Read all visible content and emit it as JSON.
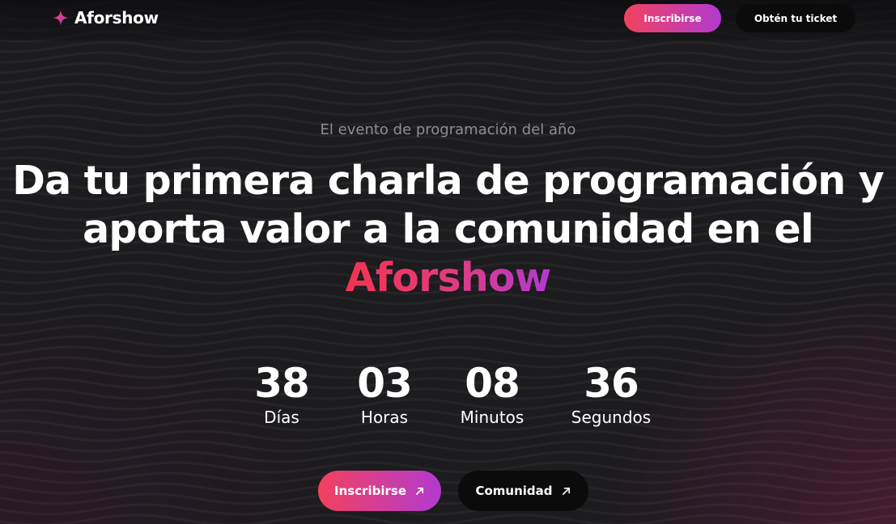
{
  "brand": {
    "name": "Aforshow",
    "logo_icon": "sparkle-icon",
    "accent_start": "#f2415e",
    "accent_end": "#b23ad0"
  },
  "nav": {
    "signup_label": "Inscribirse",
    "ticket_label": "Obtén tu ticket"
  },
  "hero": {
    "eyebrow": "El evento de programación del año",
    "headline_line1": "Da tu primera charla de programación y",
    "headline_line2": "aporta valor a la comunidad en el",
    "headline_brand": "Aforshow"
  },
  "countdown": [
    {
      "value": "38",
      "label": "Días"
    },
    {
      "value": "03",
      "label": "Horas"
    },
    {
      "value": "08",
      "label": "Minutos"
    },
    {
      "value": "36",
      "label": "Segundos"
    }
  ],
  "cta": {
    "signup_label": "Inscribirse",
    "signup_icon": "arrow-up-right-icon",
    "community_label": "Comunidad",
    "community_icon": "arrow-up-right-icon"
  }
}
